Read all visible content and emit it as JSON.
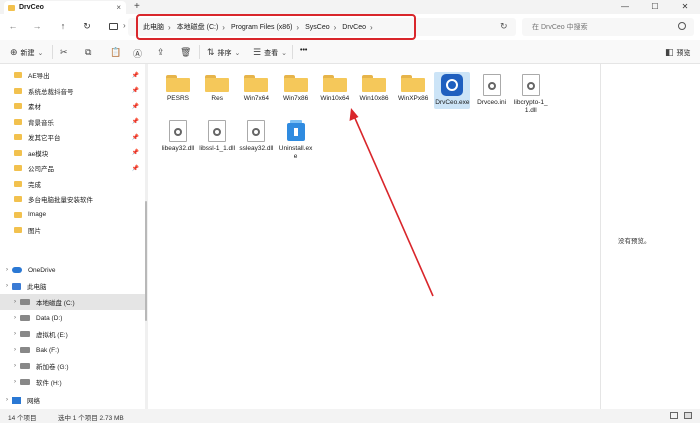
{
  "titlebar": {
    "tab_title": "DrvCeo",
    "close_glyph": "×",
    "new_tab_glyph": "+",
    "minimize": "—",
    "maximize": "☐",
    "close": "✕"
  },
  "nav": {
    "back": "←",
    "forward": "→",
    "up": "↑",
    "refresh": "↻",
    "chevron": "›"
  },
  "breadcrumb": [
    "此电脑",
    "本地磁盘 (C:)",
    "Program Files (x86)",
    "SysCeo",
    "DrvCeo"
  ],
  "search": {
    "placeholder": "在 DrvCeo 中搜索"
  },
  "toolbar": {
    "new_label": "新建",
    "sort_label": "排序",
    "view_label": "查看",
    "more_label": "•••",
    "preview_label": "预览"
  },
  "sidebar": {
    "quick": [
      {
        "label": "AE导出"
      },
      {
        "label": "系统总裁抖音号"
      },
      {
        "label": "素材"
      },
      {
        "label": "背景音乐"
      },
      {
        "label": "发其它平台"
      },
      {
        "label": "ae模块"
      },
      {
        "label": "公司产品"
      },
      {
        "label": "完成"
      },
      {
        "label": "多台电脑批量安装软件"
      },
      {
        "label": "Image"
      },
      {
        "label": "图片"
      }
    ],
    "onedrive": "OneDrive",
    "thispc": "此电脑",
    "drives": [
      "本地磁盘 (C:)",
      "Data (D:)",
      "虚拟机 (E:)",
      "Bak (F:)",
      "新加卷 (G:)",
      "软件 (H:)"
    ],
    "network": "网络"
  },
  "files": [
    {
      "name": "PESRS",
      "type": "folder"
    },
    {
      "name": "Res",
      "type": "folder"
    },
    {
      "name": "Win7x64",
      "type": "folder"
    },
    {
      "name": "Win7x86",
      "type": "folder"
    },
    {
      "name": "Win10x64",
      "type": "folder"
    },
    {
      "name": "Win10x86",
      "type": "folder"
    },
    {
      "name": "WinXPx86",
      "type": "folder"
    },
    {
      "name": "DrvCeo.exe",
      "type": "app",
      "selected": true
    },
    {
      "name": "Drvceo.ini",
      "type": "doc"
    },
    {
      "name": "libcrypto-1_1.dll",
      "type": "doc"
    },
    {
      "name": "libeay32.dll",
      "type": "doc"
    },
    {
      "name": "libssl-1_1.dll",
      "type": "doc"
    },
    {
      "name": "ssleay32.dll",
      "type": "doc"
    },
    {
      "name": "Uninstall.exe",
      "type": "setup"
    }
  ],
  "preview": {
    "text": "没有预览。"
  },
  "status": {
    "count": "14 个项目",
    "selected": "选中 1 个项目  2.73 MB"
  },
  "colors": {
    "highlight_red": "#d9262b",
    "folder": "#f5c85a",
    "selection": "#cce4f7"
  }
}
